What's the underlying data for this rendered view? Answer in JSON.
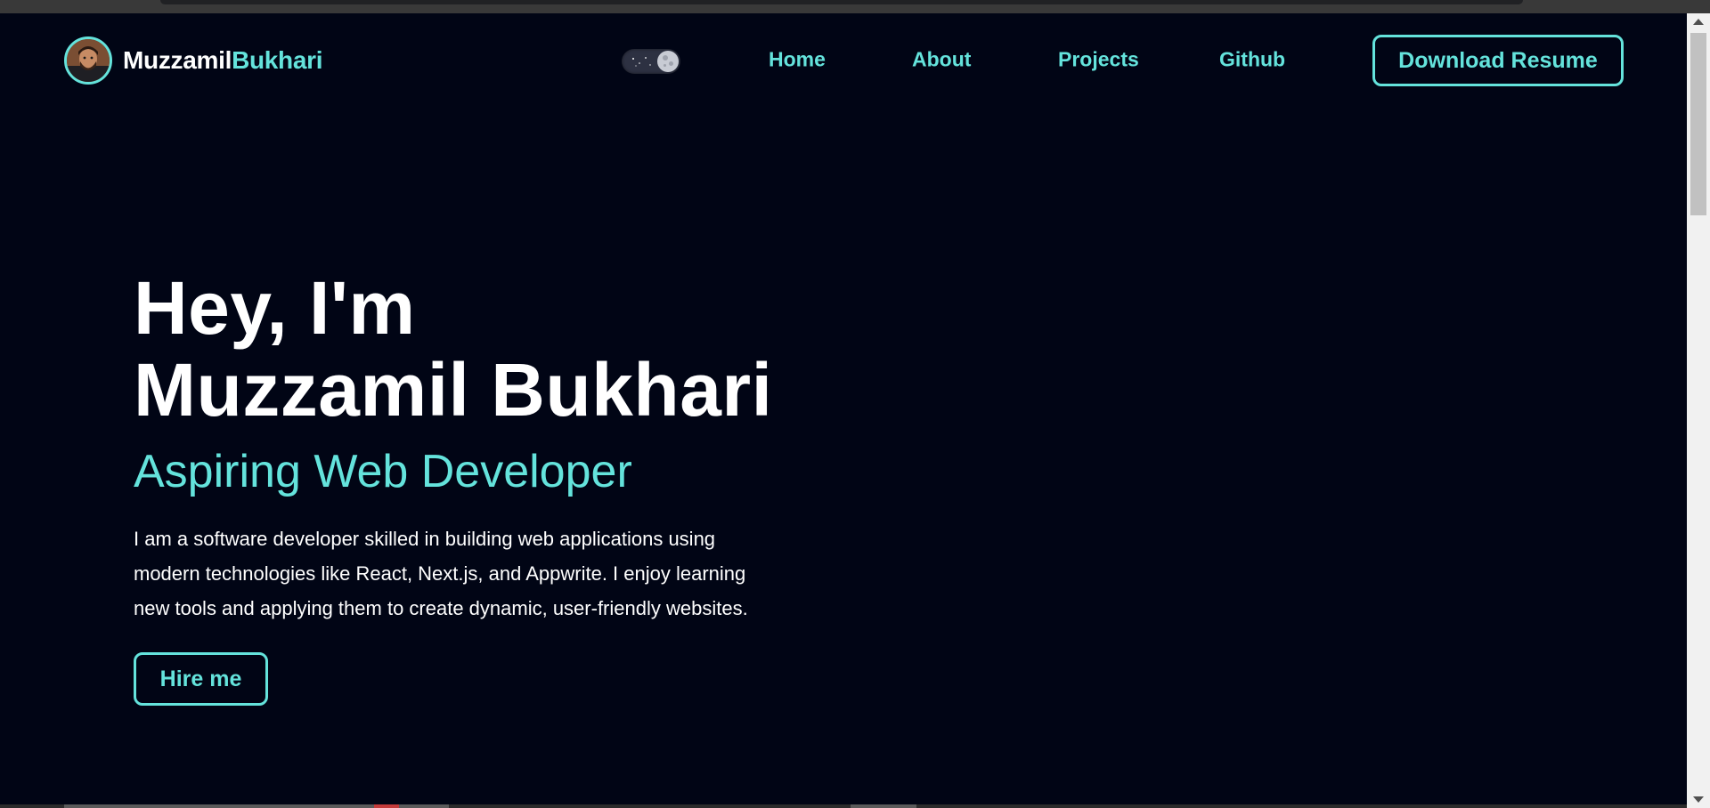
{
  "brand": {
    "first_name": "Muzzamil",
    "last_name": "Bukhari",
    "avatar_icon": "avatar-icon"
  },
  "theme_toggle": {
    "mode": "dark",
    "icon": "moon-icon"
  },
  "nav": {
    "links": [
      {
        "label": "Home"
      },
      {
        "label": "About"
      },
      {
        "label": "Projects"
      },
      {
        "label": "Github"
      }
    ],
    "resume_label": "Download Resume"
  },
  "hero": {
    "greeting": "Hey, I'm",
    "name": "Muzzamil Bukhari",
    "role": "Aspiring Web Developer",
    "description_lines": [
      "I am a software developer skilled in building web applications using",
      "modern technologies like React, Next.js, and Appwrite. I enjoy learning",
      "new tools and applying them to create dynamic, user-friendly websites."
    ],
    "cta_label": "Hire me"
  },
  "colors": {
    "background": "#010515",
    "accent": "#64e3dc",
    "text": "#ffffff"
  }
}
